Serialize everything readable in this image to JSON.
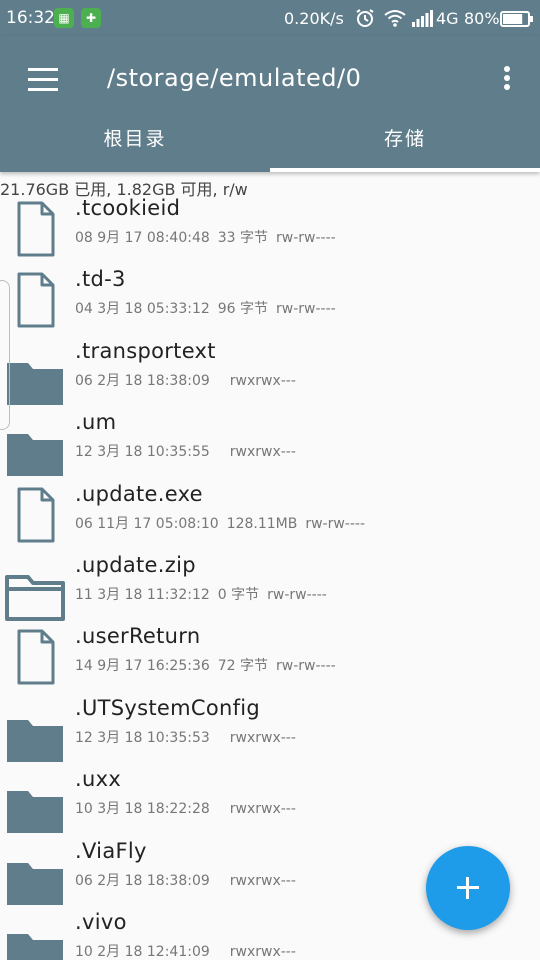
{
  "status_bar": {
    "time": "16:32",
    "app_icon_1": "sheet-app-icon",
    "app_icon_2": "wechat-icon",
    "net_speed": "0.20K/s",
    "network_type": "4G",
    "battery": "80%",
    "battery_level": 0.8
  },
  "appbar": {
    "path": "/storage/emulated/0",
    "tabs": [
      {
        "label": "根目录",
        "active": false
      },
      {
        "label": "存储",
        "active": true
      }
    ],
    "colors": {
      "primary": "#607d8b",
      "accent": "#1e9be9"
    }
  },
  "storage_info": "21.76GB 已用, 1.82GB 可用, r/w",
  "files": [
    {
      "name": ".tcookieid",
      "type": "file",
      "date": "08 9月 17 08:40:48",
      "size": "33 字节",
      "perms": "rw-rw----"
    },
    {
      "name": ".td-3",
      "type": "file",
      "date": "04 3月 18 05:33:12",
      "size": "96 字节",
      "perms": "rw-rw----"
    },
    {
      "name": ".transportext",
      "type": "folder",
      "date": "06 2月 18 18:38:09",
      "size": "",
      "perms": "rwxrwx---"
    },
    {
      "name": ".um",
      "type": "folder",
      "date": "12 3月 18 10:35:55",
      "size": "",
      "perms": "rwxrwx---"
    },
    {
      "name": ".update.exe",
      "type": "file",
      "date": "06 11月 17 05:08:10",
      "size": "128.11MB",
      "perms": "rw-rw----"
    },
    {
      "name": ".update.zip",
      "type": "archive",
      "date": "11 3月 18 11:32:12",
      "size": "0 字节",
      "perms": "rw-rw----"
    },
    {
      "name": ".userReturn",
      "type": "file",
      "date": "14 9月 17 16:25:36",
      "size": "72 字节",
      "perms": "rw-rw----"
    },
    {
      "name": ".UTSystemConfig",
      "type": "folder",
      "date": "12 3月 18 10:35:53",
      "size": "",
      "perms": "rwxrwx---"
    },
    {
      "name": ".uxx",
      "type": "folder",
      "date": "10 3月 18 18:22:28",
      "size": "",
      "perms": "rwxrwx---"
    },
    {
      "name": ".ViaFly",
      "type": "folder",
      "date": "06 2月 18 18:38:09",
      "size": "",
      "perms": "rwxrwx---"
    },
    {
      "name": ".vivo",
      "type": "folder",
      "date": "10 2月 18 12:41:09",
      "size": "",
      "perms": "rwxrwx---"
    }
  ],
  "fab": {
    "icon": "plus-icon"
  }
}
